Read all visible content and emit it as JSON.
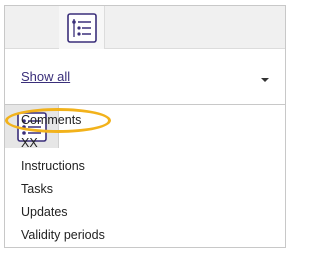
{
  "tabs": {
    "list_view_icon": "list-view-icon",
    "tree_view_icon": "tree-view-icon"
  },
  "filter": {
    "show_all_label": "Show all",
    "dropdown_icon": "chevron-down-icon"
  },
  "list": {
    "items": [
      {
        "label": "Comments"
      },
      {
        "label": "XX"
      },
      {
        "label": "Instructions"
      },
      {
        "label": "Tasks"
      },
      {
        "label": "Updates"
      },
      {
        "label": "Validity periods"
      }
    ],
    "highlighted_item": "Comments"
  },
  "colors": {
    "accent": "#3a2f7a",
    "highlight": "#f2b21b",
    "tab_background": "#f0f0f0"
  }
}
